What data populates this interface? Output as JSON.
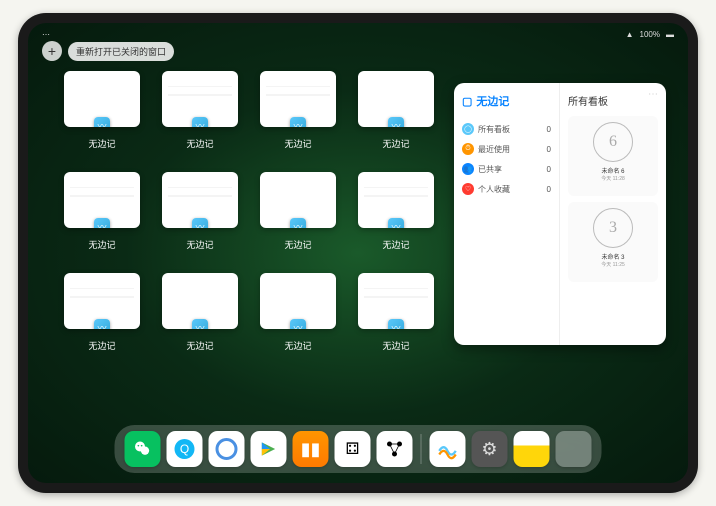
{
  "status": {
    "battery": "100%",
    "wifi": "●●●"
  },
  "top": {
    "add": "+",
    "reopen_label": "重新打开已关闭的窗口"
  },
  "window_label": "无边记",
  "windows": [
    {
      "content": false
    },
    {
      "content": true
    },
    {
      "content": true
    },
    {
      "content": false
    },
    {
      "content": true
    },
    {
      "content": true
    },
    {
      "content": false
    },
    {
      "content": true
    },
    {
      "content": true
    },
    {
      "content": false
    },
    {
      "content": false
    },
    {
      "content": true
    }
  ],
  "preview": {
    "title": "无边记",
    "right_title": "所有看板",
    "items": [
      {
        "label": "所有看板",
        "count": "0",
        "color": "#5ac8fa",
        "glyph": "◯"
      },
      {
        "label": "最近使用",
        "count": "0",
        "color": "#ff9500",
        "glyph": "⏱"
      },
      {
        "label": "已共享",
        "count": "0",
        "color": "#0a84ff",
        "glyph": "👥"
      },
      {
        "label": "个人收藏",
        "count": "0",
        "color": "#ff3b30",
        "glyph": "♡"
      }
    ],
    "boards": [
      {
        "glyph": "6",
        "title": "未命名 6",
        "sub": "今天 11:28"
      },
      {
        "glyph": "3",
        "title": "未命名 3",
        "sub": "今天 11:25"
      }
    ]
  },
  "dock": [
    {
      "name": "wechat",
      "glyph": "✦"
    },
    {
      "name": "qq",
      "glyph": "Q"
    },
    {
      "name": "quark",
      "glyph": ""
    },
    {
      "name": "play",
      "glyph": ""
    },
    {
      "name": "books",
      "glyph": "▮▮"
    },
    {
      "name": "dice",
      "glyph": "⚃"
    },
    {
      "name": "nodes",
      "glyph": "⋮⋮"
    },
    {
      "name": "freeform",
      "glyph": "〰"
    },
    {
      "name": "settings",
      "glyph": "⚙"
    },
    {
      "name": "notes",
      "glyph": ""
    },
    {
      "name": "appgroup",
      "glyph": ""
    }
  ]
}
